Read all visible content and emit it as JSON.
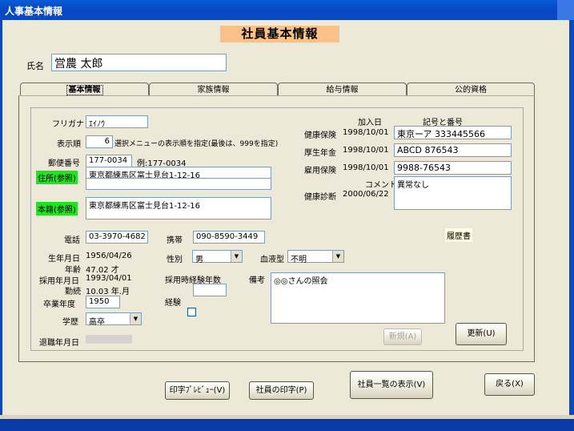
{
  "window": {
    "title": "人事基本情報"
  },
  "header": {
    "title": "社員基本情報"
  },
  "employee": {
    "name_label": "氏名",
    "name_value": "営農 太郎"
  },
  "tabs": [
    {
      "label": "基本情報"
    },
    {
      "label": "家族情報"
    },
    {
      "label": "給与情報"
    },
    {
      "label": "公的資格"
    }
  ],
  "basic": {
    "furigana_label": "フリガナ",
    "furigana_value": "ｴｲﾉｳ",
    "order_label": "表示順",
    "order_value": "6",
    "order_note": "選択メニューの表示順を指定(最後は、999を指定)",
    "zip_label": "郵便番号",
    "zip_value": "177-0034",
    "zip_example": "例:177-0034",
    "address_button": "住所(参照)",
    "address_line1": "東京都練馬区富士見台1-12-16",
    "address_line2": "",
    "domicile_button": "本籍(参照)",
    "domicile_value": "東京都練馬区富士見台1-12-16",
    "phone_label": "電話",
    "phone_value": "03-3970-4682",
    "mobile_label": "携帯",
    "mobile_value": "090-8590-3449",
    "birth_label": "生年月日",
    "birth_value": "1956/04/26",
    "age_label": "年齢",
    "age_value": "47.02 才",
    "hire_label": "採用年月日",
    "hire_value": "1993/04/01",
    "tenure_label": "勤続",
    "tenure_value": "10.03 年.月",
    "grad_label": "卒業年度",
    "grad_value": "1950",
    "edu_label": "学歴",
    "edu_value": "高卒",
    "retire_label": "退職年月日",
    "gender_label": "性別",
    "gender_value": "男",
    "blood_label": "血液型",
    "blood_value": "不明",
    "exp_years_label": "採用時経験年数",
    "exp_years_value": "",
    "exp_label": "経験",
    "note_label": "備考",
    "note_value": "◎◎さんの照会"
  },
  "insurance": {
    "col_joined": "加入日",
    "col_number": "記号と番号",
    "rows": [
      {
        "label": "健康保険",
        "date": "1998/10/01",
        "number": "東京ーア 333445566"
      },
      {
        "label": "厚生年金",
        "date": "1998/10/01",
        "number": "ABCD 876543"
      },
      {
        "label": "雇用保険",
        "date": "1998/10/01",
        "number": "9988-76543"
      }
    ],
    "comment_label": "コメント",
    "checkup_label": "健康診断",
    "checkup_date": "2000/06/22",
    "checkup_comment": "異常なし",
    "resume_label": "履歴書"
  },
  "buttons": {
    "new": "新規(A)",
    "update": "更新(U)",
    "preview": "印字ﾌﾟﾚﾋﾞｭｰ(V)",
    "print": "社員の印字(P)",
    "list": "社員一覧の表示(V)",
    "back": "戻る(X)"
  },
  "colors": {
    "title_bg": "#f9c087",
    "address_btn": "#22e322",
    "titlebar": "#0549c7"
  }
}
